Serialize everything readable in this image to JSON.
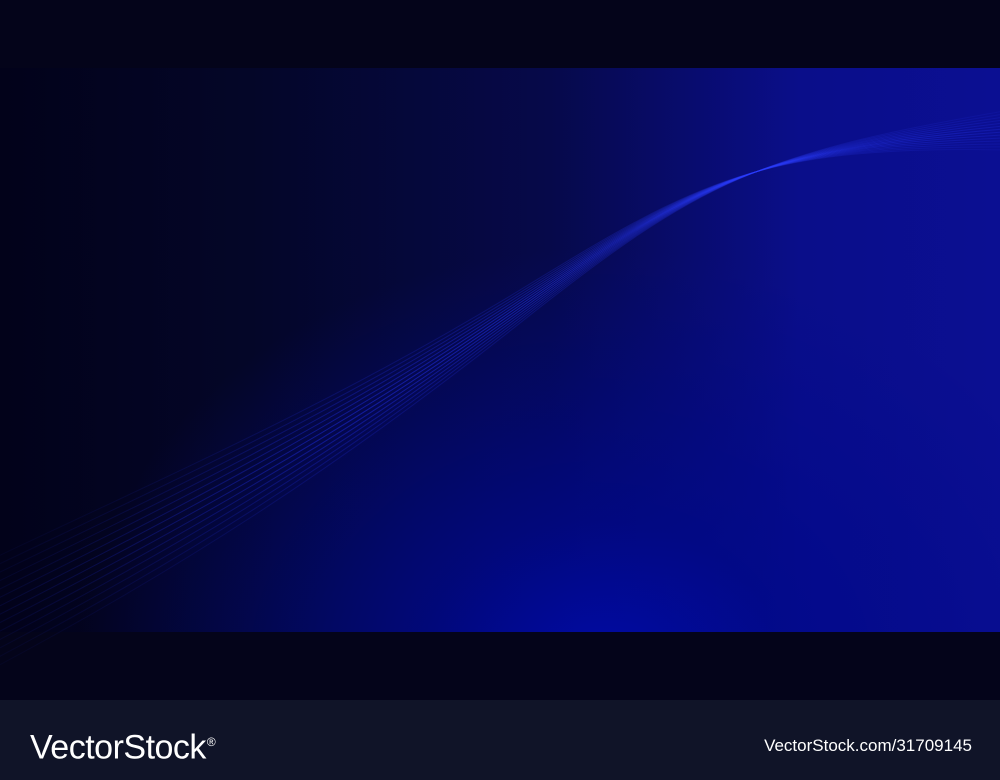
{
  "image": {
    "subject": "abstract-wave-background",
    "colors": {
      "background": "#04041a",
      "panel_deep": "#02021a",
      "panel_glow": "#0b0f92",
      "wave_line": "#2030ff",
      "footer": "#101428",
      "footer_text": "#ffffff"
    }
  },
  "watermark": {
    "brand": "VectorStock",
    "registered_mark": "®",
    "image_id": "VectorStock.com/31709145"
  }
}
